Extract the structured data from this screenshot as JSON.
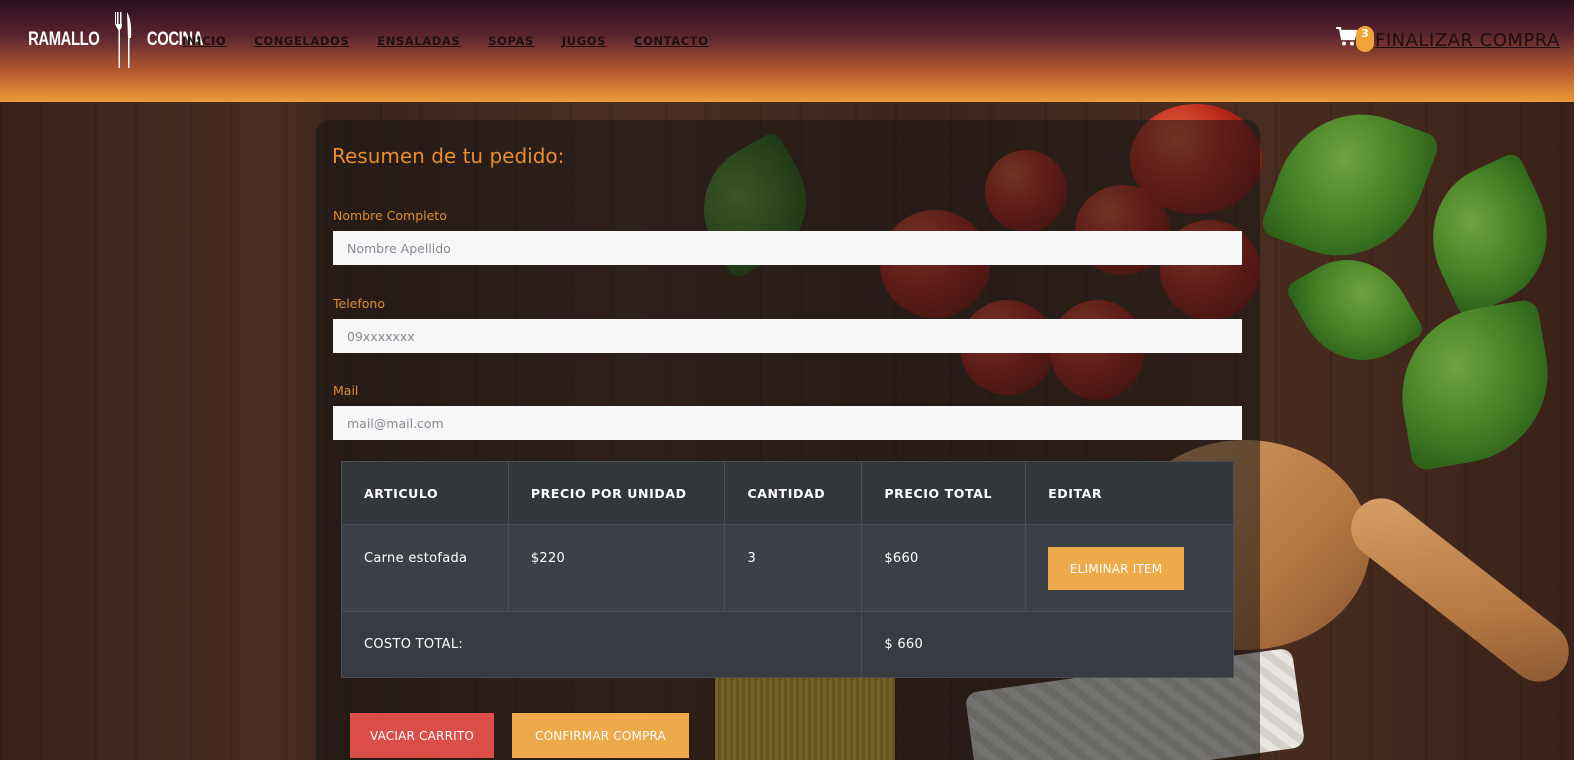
{
  "brand": {
    "left_word": "RAMALLO",
    "right_word": "COCINA"
  },
  "nav": {
    "items": [
      "INICIO",
      "CONGELADOS",
      "ENSALADAS",
      "SOPAS",
      "JUGOS",
      "CONTACTO"
    ]
  },
  "cart": {
    "count": "3",
    "checkout_label": "FINALIZAR COMPRA"
  },
  "form": {
    "title": "Resumen de tu pedido:",
    "name": {
      "label": "Nombre Completo",
      "placeholder": "Nombre Apellido",
      "value": ""
    },
    "phone": {
      "label": "Telefono",
      "placeholder": "09xxxxxxx",
      "value": ""
    },
    "mail": {
      "label": "Mail",
      "placeholder": "mail@mail.com",
      "value": ""
    }
  },
  "table": {
    "headers": [
      "ARTICULO",
      "PRECIO POR UNIDAD",
      "CANTIDAD",
      "PRECIO TOTAL",
      "EDITAR"
    ],
    "rows": [
      {
        "article": "Carne estofada",
        "unit_price": "$220",
        "quantity": "3",
        "total": "$660",
        "action": "ELIMINAR ITEM"
      }
    ],
    "total_label": "COSTO TOTAL:",
    "total_value": "$ 660"
  },
  "actions": {
    "empty_cart": "VACIAR CARRITO",
    "confirm": "CONFIRMAR COMPRA"
  },
  "colors": {
    "accent": "#eda94a",
    "danger": "#db4e47",
    "title": "#ea8e2c",
    "table_bg": "#383c42"
  },
  "icons": [
    "fork-knife-icon",
    "cart-icon"
  ]
}
